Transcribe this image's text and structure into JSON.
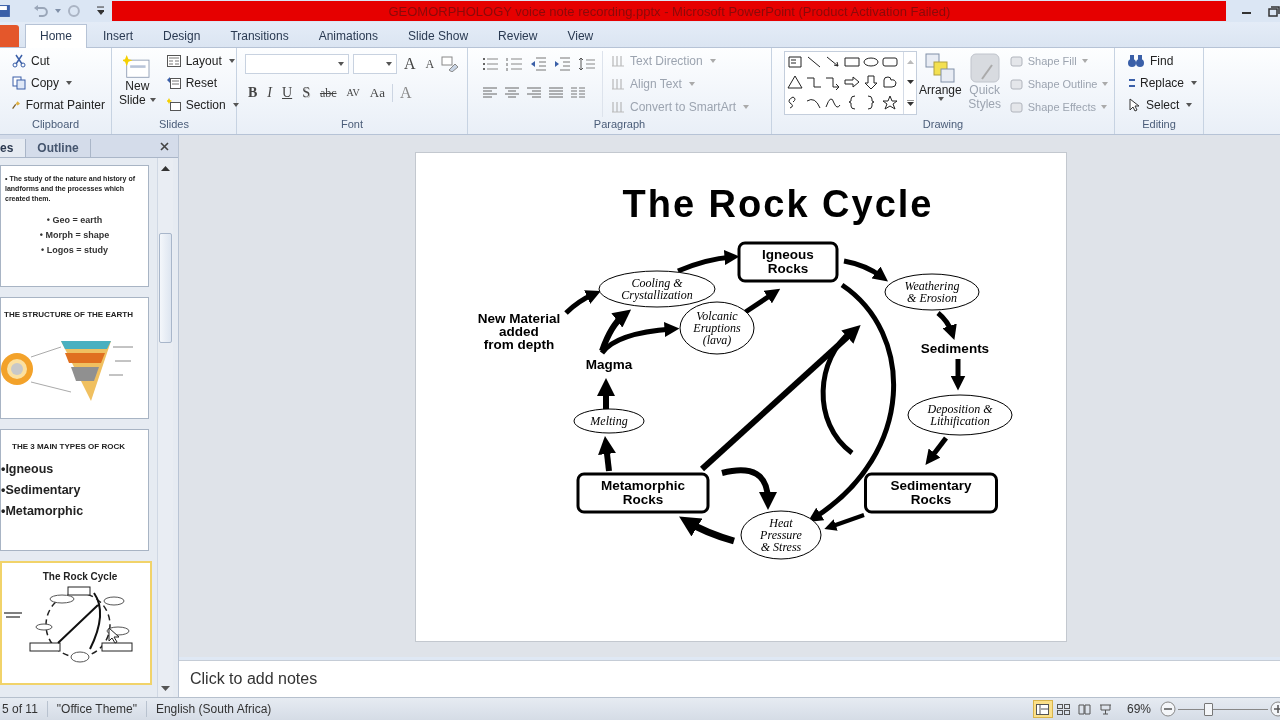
{
  "window": {
    "title": "GEOMORPHOLOGY voice note recording.pptx - Microsoft PowerPoint (Product Activation Failed)"
  },
  "ribbon_tabs": [
    {
      "label": "Home",
      "selected": true
    },
    {
      "label": "Insert",
      "selected": false
    },
    {
      "label": "Design",
      "selected": false
    },
    {
      "label": "Transitions",
      "selected": false
    },
    {
      "label": "Animations",
      "selected": false
    },
    {
      "label": "Slide Show",
      "selected": false
    },
    {
      "label": "Review",
      "selected": false
    },
    {
      "label": "View",
      "selected": false
    }
  ],
  "clipboard": {
    "label": "Clipboard",
    "cut": "Cut",
    "copy": "Copy",
    "format_painter": "Format Painter"
  },
  "slides_group": {
    "label": "Slides",
    "new_slide": [
      "New",
      "Slide"
    ],
    "layout": "Layout",
    "reset": "Reset",
    "section": "Section"
  },
  "font": {
    "label": "Font",
    "grow": "A",
    "shrink": "A",
    "buttons": [
      "B",
      "I",
      "U",
      "S",
      "abc",
      "AV",
      "Aa"
    ],
    "color_button": "A"
  },
  "paragraph": {
    "label": "Paragraph",
    "commands": [
      {
        "label": "Text Direction",
        "disabled": true
      },
      {
        "label": "Align Text",
        "disabled": true
      },
      {
        "label": "Convert to SmartArt",
        "disabled": true
      }
    ]
  },
  "drawing": {
    "label": "Drawing",
    "arrange": "Arrange",
    "quick_styles": {
      "label": "Quick Styles",
      "disabled": true
    },
    "commands": [
      {
        "label": "Shape Fill",
        "disabled": true
      },
      {
        "label": "Shape Outline",
        "disabled": true
      },
      {
        "label": "Shape Effects",
        "disabled": true
      }
    ]
  },
  "editing": {
    "label": "Editing",
    "find": "Find",
    "replace": "Replace",
    "select": "Select"
  },
  "slide_pane": {
    "tabs": [
      {
        "label": "es",
        "selected": true
      },
      {
        "label": "Outline",
        "selected": false
      }
    ],
    "thumbnails": [
      {
        "kind": "text",
        "selected": false,
        "intro": "• The study of the nature and history of landforms and the processes which created them.",
        "bullets": [
          "•  Geo = earth",
          "• Morph = shape",
          "• Logos = study"
        ]
      },
      {
        "kind": "picture",
        "selected": false,
        "title": "THE STRUCTURE OF THE EARTH"
      },
      {
        "kind": "list",
        "selected": false,
        "title": "THE 3 MAIN TYPES OF ROCK",
        "bullets": [
          "•Igneous",
          "•Sedimentary",
          "•Metamorphic"
        ]
      },
      {
        "kind": "diagram",
        "selected": true,
        "title": "The Rock Cycle"
      }
    ]
  },
  "slide": {
    "title": "The Rock Cycle",
    "nodes": [
      {
        "kind": "box",
        "lines": [
          "Igneous",
          "Rocks"
        ]
      },
      {
        "kind": "ellipse",
        "lines": [
          "Cooling &",
          "Crystallization"
        ]
      },
      {
        "kind": "ellipse",
        "lines": [
          "Volcanic",
          "Eruptions",
          "(lava)"
        ]
      },
      {
        "kind": "ellipse",
        "lines": [
          "Weathering",
          "& Erosion"
        ]
      },
      {
        "kind": "label",
        "lines": [
          "New Material",
          "added",
          "from depth"
        ]
      },
      {
        "kind": "label",
        "lines": [
          "Magma"
        ]
      },
      {
        "kind": "label",
        "lines": [
          "Sediments"
        ]
      },
      {
        "kind": "ellipse",
        "lines": [
          "Melting"
        ]
      },
      {
        "kind": "ellipse",
        "lines": [
          "Deposition &",
          "Lithification"
        ]
      },
      {
        "kind": "box",
        "lines": [
          "Metamorphic",
          "Rocks"
        ]
      },
      {
        "kind": "box",
        "lines": [
          "Sedimentary",
          "Rocks"
        ]
      },
      {
        "kind": "ellipse",
        "lines": [
          "Heat",
          "Pressure",
          "& Stress"
        ]
      }
    ]
  },
  "notes": {
    "placeholder": "Click to add notes"
  },
  "status_bar": {
    "slide": "5 of 11",
    "theme": "\"Office Theme\"",
    "language": "English (South Africa)",
    "views": [
      {
        "kind": "normal",
        "selected": true
      },
      {
        "kind": "sorter",
        "selected": false
      },
      {
        "kind": "reading",
        "selected": false
      },
      {
        "kind": "show",
        "selected": false
      }
    ],
    "zoom": "69%",
    "zoom_slider": {
      "level": 0.33
    }
  }
}
